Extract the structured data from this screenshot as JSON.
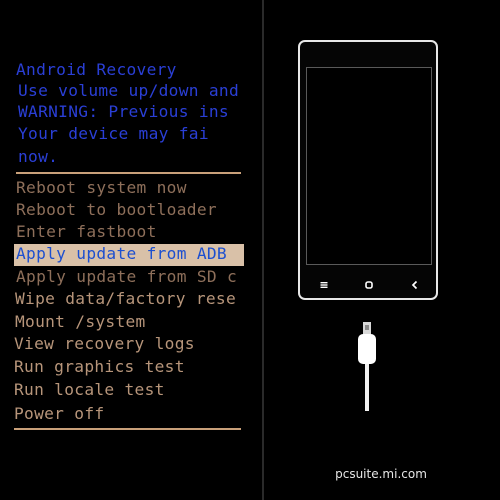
{
  "recovery": {
    "title": "Android Recovery",
    "line1": "Use volume up/down and",
    "line2": "WARNING: Previous ins",
    "line3": "  Your device may fai",
    "line4": "now.",
    "menu": [
      {
        "label": "Reboot system now"
      },
      {
        "label": "Reboot to bootloader"
      },
      {
        "label": "Enter fastboot"
      },
      {
        "label": "Apply update from ADB",
        "selected": true
      },
      {
        "label": "Apply update from SD c"
      },
      {
        "label": "Wipe data/factory rese"
      },
      {
        "label": "Mount /system"
      },
      {
        "label": "View recovery logs"
      },
      {
        "label": "Run graphics test"
      },
      {
        "label": "Run locale test"
      },
      {
        "label": "Power off"
      }
    ]
  },
  "phone": {
    "nav_keys": [
      "menu-icon",
      "home-icon",
      "back-icon"
    ]
  },
  "footer": {
    "url": "pcsuite.mi.com"
  },
  "colors": {
    "header_text": "#2a3fd6",
    "menu_text": "#b7957a",
    "selected_bg": "#d9c1a8",
    "selected_text": "#1c4fd0",
    "rule": "#c9a07a"
  }
}
